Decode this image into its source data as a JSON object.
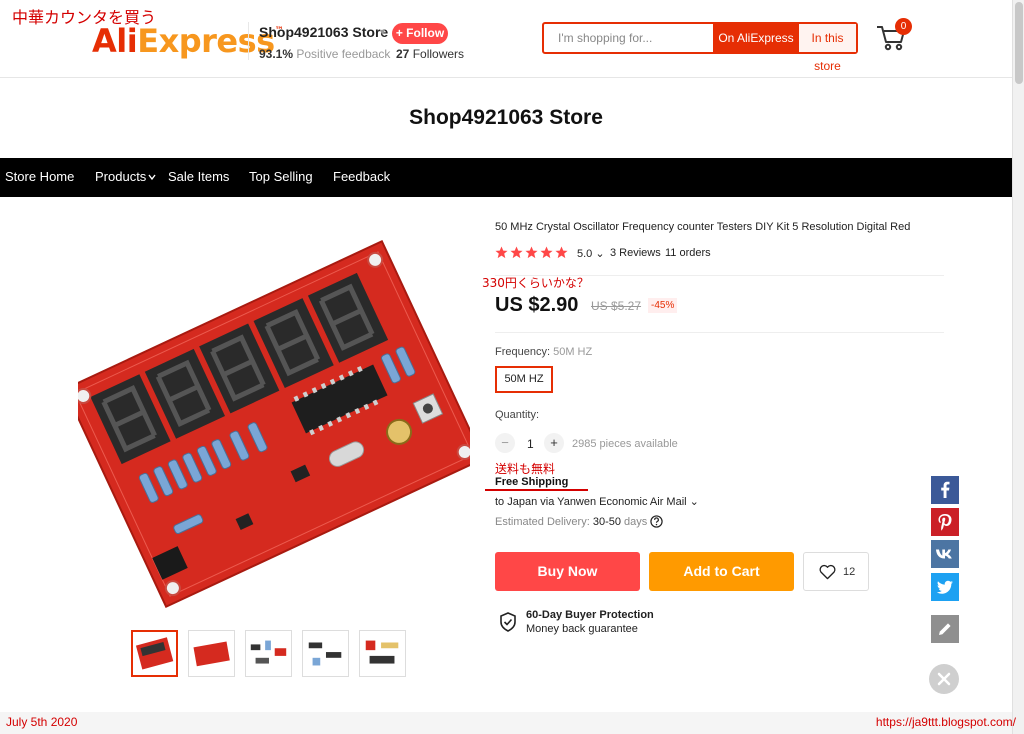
{
  "annotations": {
    "top_note": "中華カウンタを買う",
    "price_note": "330円くらいかな？",
    "shipping_note": "送料も無料",
    "date": "July 5th 2020",
    "blog_url": "https://ja9ttt.blogspot.com/"
  },
  "header": {
    "logo_ali": "Ali",
    "logo_express": "Express",
    "logo_tm": "™",
    "store_name": "Shop4921063 Store",
    "feedback_pct": "93.1%",
    "feedback_label": "Positive feedback",
    "follow_label": "+ Follow",
    "followers_count": "27",
    "followers_label": "Followers",
    "search_placeholder": "I'm shopping for...",
    "search_on_aliexpress": "On AliExpress",
    "search_in_store": "In this store",
    "cart_count": "0"
  },
  "store": {
    "title": "Shop4921063 Store",
    "nav": [
      "Store Home",
      "Products",
      "Sale Items",
      "Top Selling",
      "Feedback"
    ]
  },
  "product": {
    "title": "50 MHz Crystal Oscillator Frequency counter Testers DIY Kit 5 Resolution Digital Red",
    "rating": "5.0",
    "reviews": "3 Reviews",
    "orders": "11 orders",
    "price": "US $2.90",
    "old_price": "US $5.27",
    "discount": "-45%",
    "frequency_label": "Frequency:",
    "frequency_value": "50M HZ",
    "frequency_option": "50M HZ",
    "quantity_label": "Quantity:",
    "quantity_minus": "−",
    "quantity_value": "1",
    "quantity_plus": "+",
    "available": "2985 pieces available",
    "free_shipping": "Free Shipping",
    "shipping_via": "to Japan via Yanwen Economic Air Mail",
    "delivery_label": "Estimated Delivery:",
    "delivery_value": "30-50",
    "delivery_unit": "days",
    "buy_now": "Buy Now",
    "add_to_cart": "Add to Cart",
    "wishlist_count": "12",
    "protection_title": "60-Day Buyer Protection",
    "protection_sub": "Money back guarantee"
  },
  "colors": {
    "brand_red": "#e62e04",
    "buy_red": "#ff4747",
    "cart_orange": "#ff9a00",
    "facebook": "#3b5998",
    "pinterest": "#cb2027",
    "vk": "#4c75a3",
    "twitter": "#1da1f2"
  }
}
